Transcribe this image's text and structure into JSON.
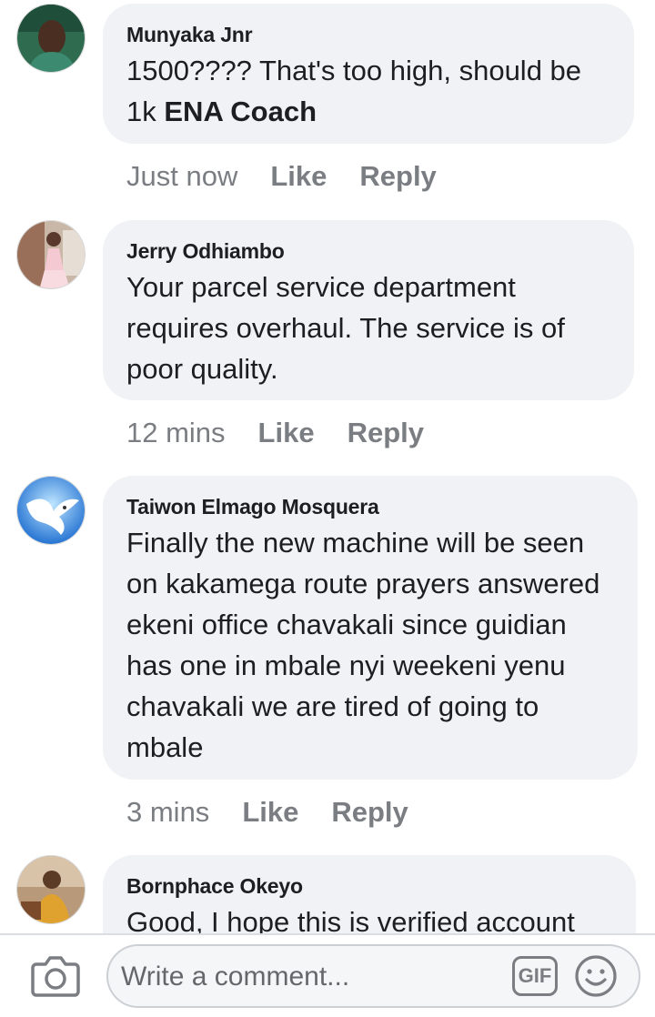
{
  "comments": [
    {
      "author": "Munyaka Jnr",
      "text": "1500???? That's too high, should be 1k",
      "tag": "ENA Coach",
      "time": "Just now",
      "like_label": "Like",
      "reply_label": "Reply",
      "avatar_icon": "profile-photo-portrait"
    },
    {
      "author": "Jerry Odhiambo",
      "text": "Your parcel service department requires overhaul. The service is  of poor quality.",
      "time": "12 mins",
      "like_label": "Like",
      "reply_label": "Reply",
      "avatar_icon": "profile-photo-child"
    },
    {
      "author": "Taiwon Elmago Mosquera",
      "text": "Finally the new machine will be seen on kakamega route prayers answered ekeni office  chavakali since guidian has one in mbale nyi weekeni yenu chavakali we are tired of going to mbale",
      "time": "3 mins",
      "like_label": "Like",
      "reply_label": "Reply",
      "avatar_icon": "profile-photo-dove"
    },
    {
      "author": "Bornphace Okeyo",
      "text": "Good, I hope this is verified account",
      "avatar_icon": "profile-photo-person"
    }
  ],
  "composer": {
    "placeholder": "Write a comment...",
    "gif_label": "GIF",
    "camera_icon": "camera-icon",
    "emoji_icon": "smiley-icon"
  },
  "colors": {
    "bubble": "#f0f2f5",
    "meta_text": "#7a7d82",
    "text": "#1c1e21"
  }
}
